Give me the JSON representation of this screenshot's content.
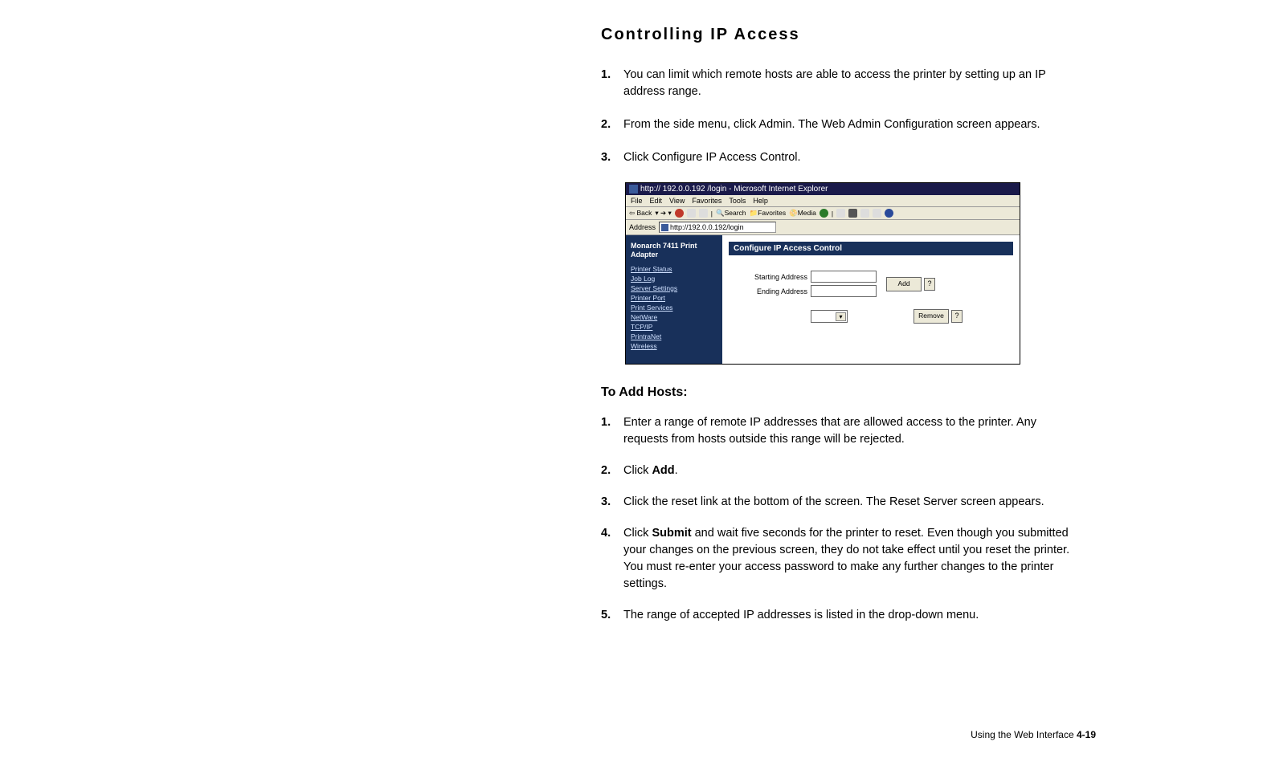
{
  "heading": "Controlling IP Access",
  "intro": [
    {
      "n": "1.",
      "t": "You can limit which remote hosts are able to access the printer by setting up an IP address range."
    },
    {
      "n": "2.",
      "t": "From the side menu, click Admin. The Web Admin Configuration screen appears."
    },
    {
      "n": "3.",
      "t": "Click Configure IP Access Control."
    }
  ],
  "ie": {
    "title": "http:// 192.0.0.192 /login - Microsoft Internet Explorer",
    "menus": [
      "File",
      "Edit",
      "View",
      "Favorites",
      "Tools",
      "Help"
    ],
    "toolbar": {
      "back": "Back",
      "search": "Search",
      "favorites": "Favorites",
      "media": "Media"
    },
    "address_label": "Address",
    "address_value": "http://192.0.0.192/login",
    "sidebar_title": "Monarch 7411 Print Adapter",
    "sidebar_links": [
      "Printer Status",
      "Job Log",
      "Server Settings",
      "Printer Port",
      "Print Services",
      "NetWare",
      "TCP/IP",
      "PrintraNet",
      "Wireless"
    ],
    "pane_title": "Configure IP Access Control",
    "starting_label": "Starting Address",
    "ending_label": "Ending Address",
    "add_btn": "Add",
    "remove_btn": "Remove",
    "help": "?",
    "select_arrow": "▾"
  },
  "subheading": "To Add Hosts:",
  "steps": [
    {
      "n": "1.",
      "parts": [
        {
          "t": "Enter a range of remote IP addresses that are allowed access to the printer. Any requests from hosts outside this range will be rejected."
        }
      ]
    },
    {
      "n": "2.",
      "parts": [
        {
          "t": "Click "
        },
        {
          "t": "Add",
          "b": true
        },
        {
          "t": "."
        }
      ]
    },
    {
      "n": "3.",
      "parts": [
        {
          "t": "Click the reset link at the bottom of the screen. The Reset Server screen appears."
        }
      ]
    },
    {
      "n": "4.",
      "parts": [
        {
          "t": "Click "
        },
        {
          "t": "Submit",
          "b": true
        },
        {
          "t": " and wait five seconds for the printer to reset. Even though you submitted your changes on the previous screen, they do not take effect until you reset the printer.\nYou must re-enter your access password to make any further changes to the printer settings."
        }
      ]
    },
    {
      "n": "5.",
      "parts": [
        {
          "t": "The range of accepted IP addresses is listed in the drop-down menu."
        }
      ]
    }
  ],
  "footer_text": "Using the Web Interface ",
  "footer_page": "4-19"
}
